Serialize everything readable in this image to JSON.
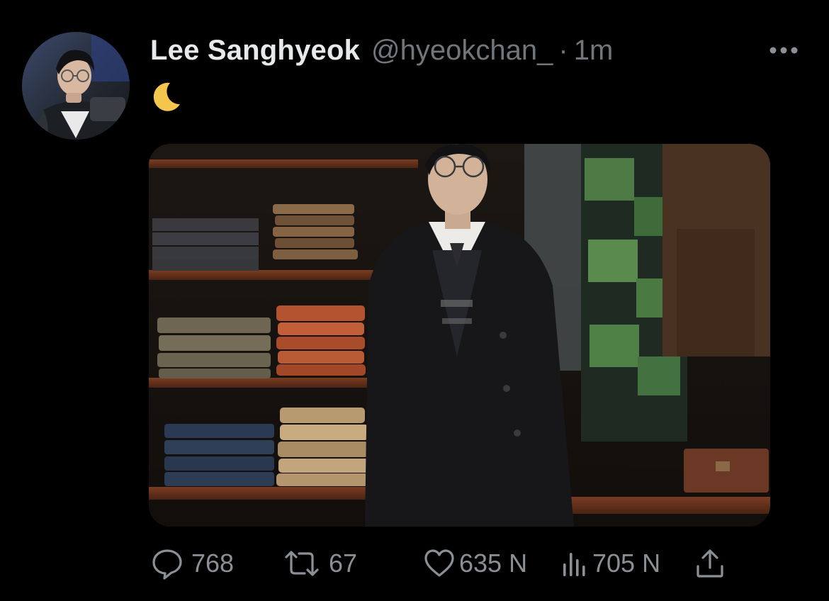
{
  "tweet": {
    "display_name": "Lee Sanghyeok",
    "handle": "@hyeokchan_",
    "separator": "·",
    "time": "1m",
    "text_emoji": "moon-emoji",
    "avatar": "avatar-photo",
    "media": "photo-of-person-in-clothing-store"
  },
  "actions": {
    "reply_count": "768",
    "retweet_count": "67",
    "like_count": "635 N",
    "views_count": "705 N",
    "icons": {
      "reply": "reply-icon",
      "retweet": "retweet-icon",
      "like": "heart-icon",
      "views": "views-icon",
      "share": "share-icon",
      "more": "more-icon"
    }
  },
  "colors": {
    "background": "#000000",
    "text_primary": "#e7e9ea",
    "text_secondary": "#71767b",
    "icon": "#8b9096",
    "moon": "#f4c64e"
  }
}
